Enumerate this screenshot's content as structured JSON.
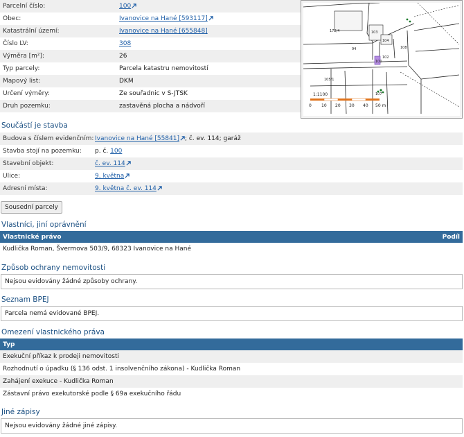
{
  "parcel_info": [
    {
      "label": "Parcelní číslo:",
      "value": "100",
      "link": true
    },
    {
      "label": "Obec:",
      "value": "Ivanovice na Hané [593117]",
      "link": true
    },
    {
      "label": "Katastrální území:",
      "value": "Ivanovice na Hané [655848]",
      "link": true
    },
    {
      "label": "Číslo LV:",
      "value": "308",
      "link": true
    },
    {
      "label": "Výměra [m²]:",
      "value": "26",
      "link": false
    },
    {
      "label": "Typ parcely:",
      "value": "Parcela katastru nemovitostí",
      "link": false
    },
    {
      "label": "Mapový list:",
      "value": "DKM",
      "link": false
    },
    {
      "label": "Určení výměry:",
      "value": "Ze souřadnic v S-JTSK",
      "link": false
    },
    {
      "label": "Druh pozemku:",
      "value": "zastavěná plocha a nádvoří",
      "link": false
    }
  ],
  "map": {
    "parcel_labels": [
      "172/4",
      "94",
      "100",
      "102",
      "103",
      "105/1",
      "104",
      "107",
      "108"
    ],
    "scale_ratio": "1:1100",
    "scale_ticks": [
      "0",
      "10",
      "20",
      "30",
      "40",
      "50 m"
    ]
  },
  "stavba": {
    "title": "Součástí je stavba",
    "building_label": "Budova s číslem evidenčním:",
    "building_link": "Ivanovice na Hané [55841]",
    "building_rest": "; č. ev. 114; garáž",
    "stands_label": "Stavba stojí na pozemku:",
    "stands_prefix": "p. č.",
    "stands_link": "100",
    "object_label": "Stavební objekt:",
    "object_link": "č. ev. 114",
    "street_label": "Ulice:",
    "street_link": "9. května",
    "address_label": "Adresní místa:",
    "address_link": "9. května č. ev. 114"
  },
  "sousedni_button": "Sousední parcely",
  "owners": {
    "title": "Vlastníci, jiní oprávnění",
    "col_left": "Vlastnické právo",
    "col_right": "Podíl",
    "rows": [
      "Kudlička Roman, Švermova 503/9, 68323 Ivanovice na Hané"
    ]
  },
  "ochrana": {
    "title": "Způsob ochrany nemovitosti",
    "text": "Nejsou evidovány žádné způsoby ochrany."
  },
  "bpej": {
    "title": "Seznam BPEJ",
    "text": "Parcela nemá evidované BPEJ."
  },
  "omezeni": {
    "title": "Omezení vlastnického práva",
    "col": "Typ",
    "rows": [
      "Exekuční příkaz k prodeji nemovitosti",
      "Rozhodnutí o úpadku (§ 136 odst. 1 insolvenčního zákona) - Kudlička Roman",
      "Zahájení exekuce - Kudlička Roman",
      "Zástavní právo exekutorské podle § 69a exekučního řádu"
    ]
  },
  "jine": {
    "title": "Jiné zápisy",
    "text": "Nejsou evidovány žádné jiné zápisy."
  }
}
